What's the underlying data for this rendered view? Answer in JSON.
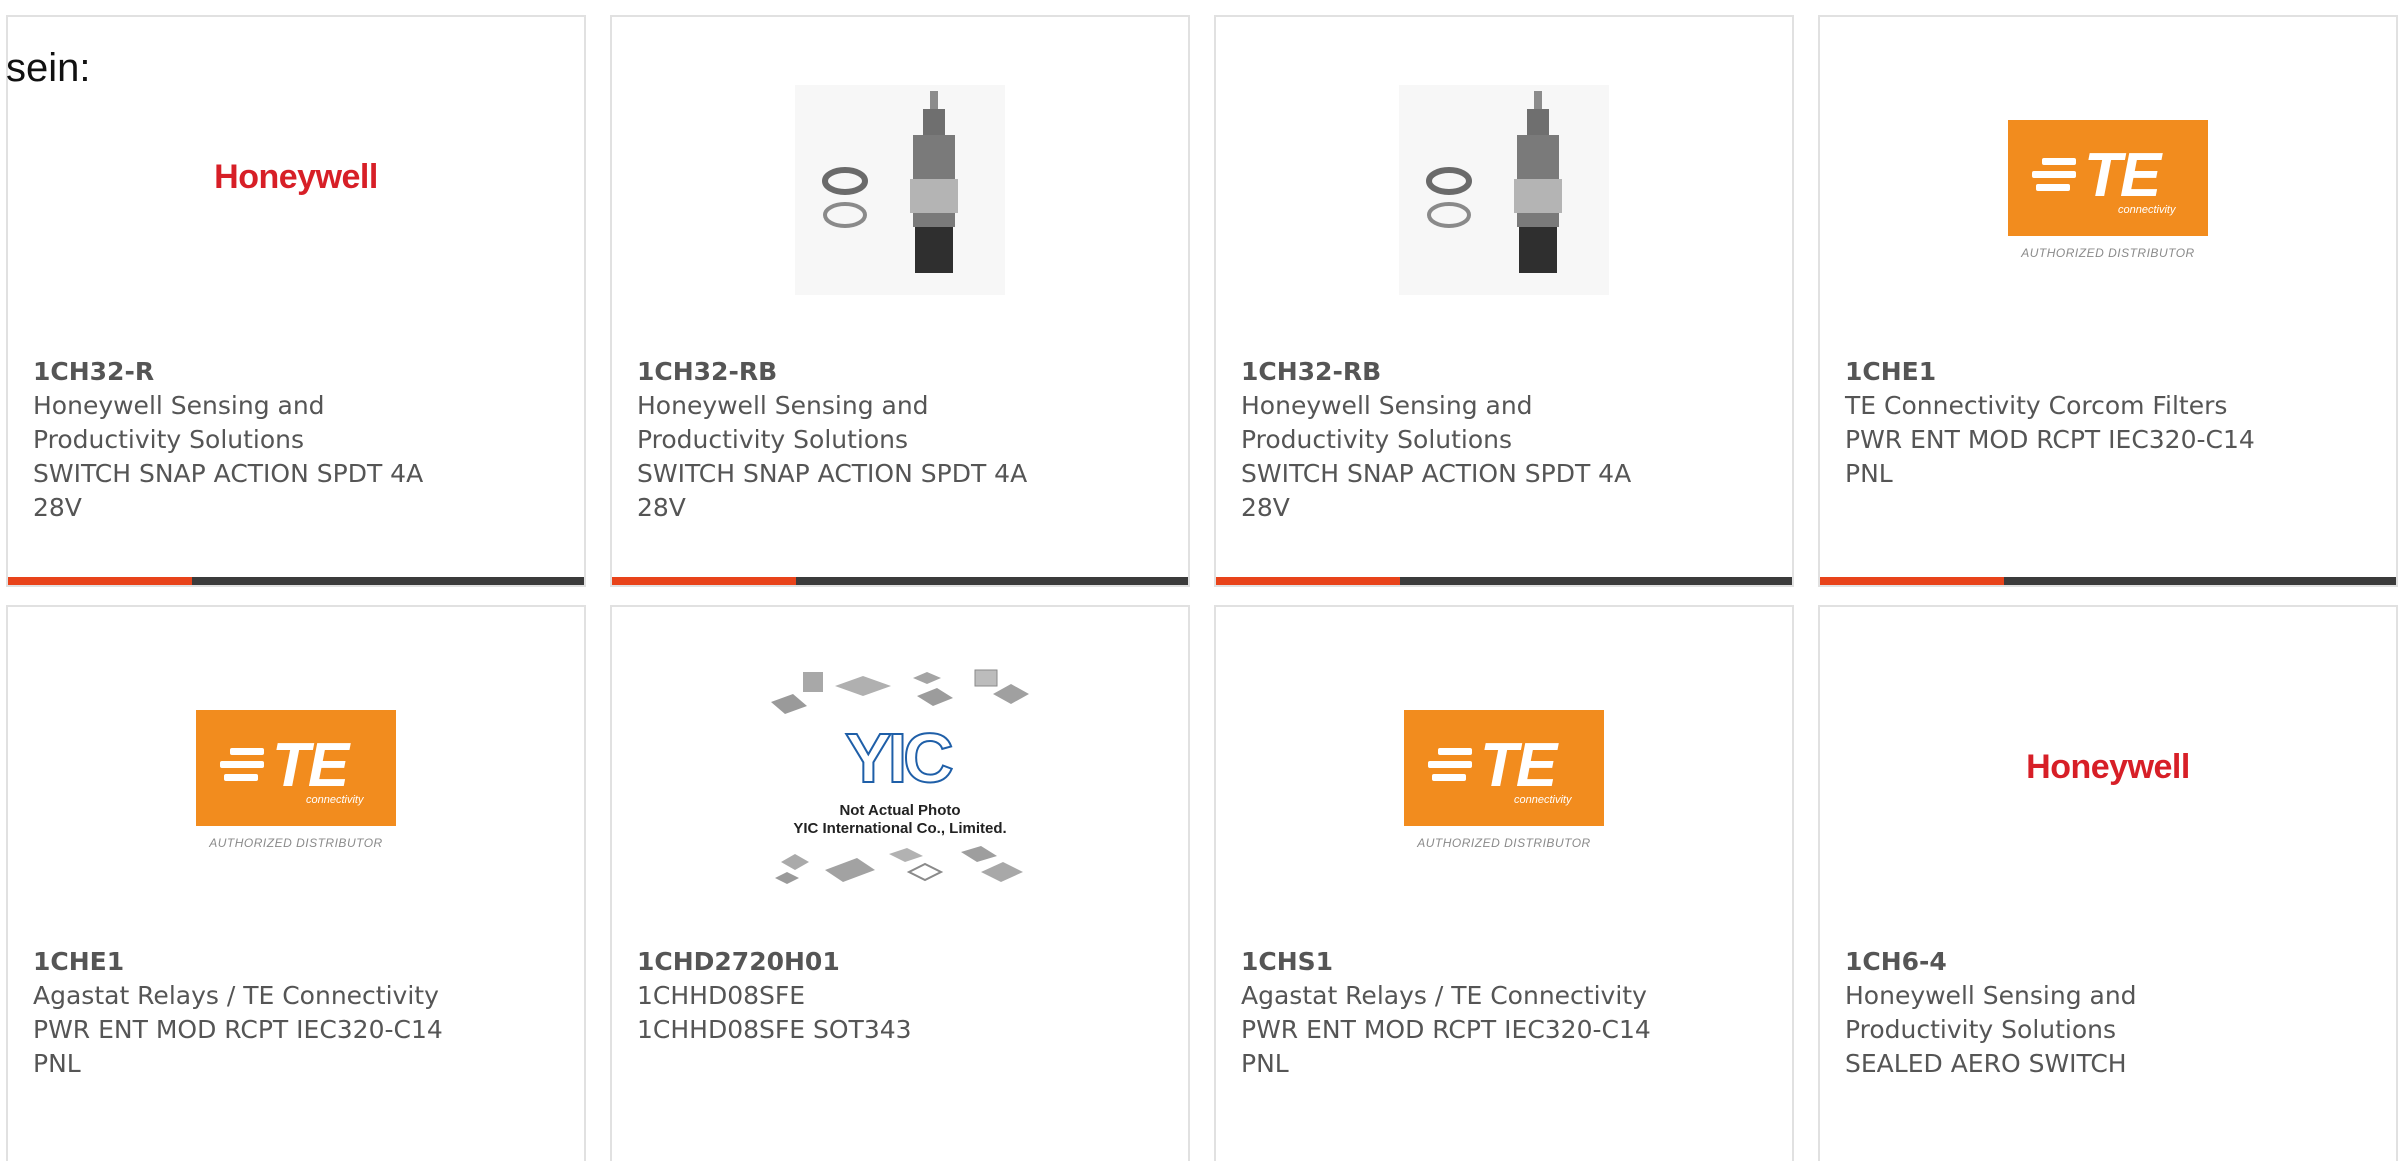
{
  "intro_text": "sein:",
  "brand_colors": {
    "accent_bar": "#e8431a",
    "bar_dark": "#3b3b3b",
    "te_orange": "#f28c1e",
    "honeywell_red": "#d71f27",
    "text_gray": "#555555"
  },
  "cards": [
    {
      "image": "honeywell-logo",
      "logo_text": "Honeywell",
      "part_number": "1CH32-R",
      "manufacturer": "Honeywell Sensing and Productivity Solutions",
      "description": "SWITCH SNAP ACTION SPDT 4A 28V"
    },
    {
      "image": "switch-photo",
      "part_number": "1CH32-RB",
      "manufacturer": "Honeywell Sensing and Productivity Solutions",
      "description": "SWITCH SNAP ACTION SPDT 4A 28V"
    },
    {
      "image": "switch-photo",
      "part_number": "1CH32-RB",
      "manufacturer": "Honeywell Sensing and Productivity Solutions",
      "description": "SWITCH SNAP ACTION SPDT 4A 28V"
    },
    {
      "image": "te-connectivity-logo",
      "logo_text": "TE",
      "logo_subtext": "connectivity",
      "logo_caption": "AUTHORIZED DISTRIBUTOR",
      "part_number": "1CHE1",
      "manufacturer": "TE Connectivity Corcom Filters",
      "description": "PWR ENT MOD RCPT IEC320-C14 PNL"
    },
    {
      "image": "te-connectivity-logo",
      "logo_text": "TE",
      "logo_subtext": "connectivity",
      "logo_caption": "AUTHORIZED DISTRIBUTOR",
      "part_number": "1CHE1",
      "manufacturer": "Agastat Relays / TE Connectivity",
      "description": "PWR ENT MOD RCPT IEC320-C14 PNL"
    },
    {
      "image": "yic-placeholder",
      "logo_text": "YIC",
      "caption_line1": "Not Actual Photo",
      "caption_line2": "YIC International Co., Limited.",
      "part_number": "1CHD2720H01",
      "manufacturer": "1CHHD08SFE",
      "description": "1CHHD08SFE SOT343"
    },
    {
      "image": "te-connectivity-logo",
      "logo_text": "TE",
      "logo_subtext": "connectivity",
      "logo_caption": "AUTHORIZED DISTRIBUTOR",
      "part_number": "1CHS1",
      "manufacturer": "Agastat Relays / TE Connectivity",
      "description": "PWR ENT MOD RCPT IEC320-C14 PNL"
    },
    {
      "image": "honeywell-logo",
      "logo_text": "Honeywell",
      "part_number": "1CH6-4",
      "manufacturer": "Honeywell Sensing and Productivity Solutions",
      "description": "SEALED AERO SWITCH"
    }
  ]
}
